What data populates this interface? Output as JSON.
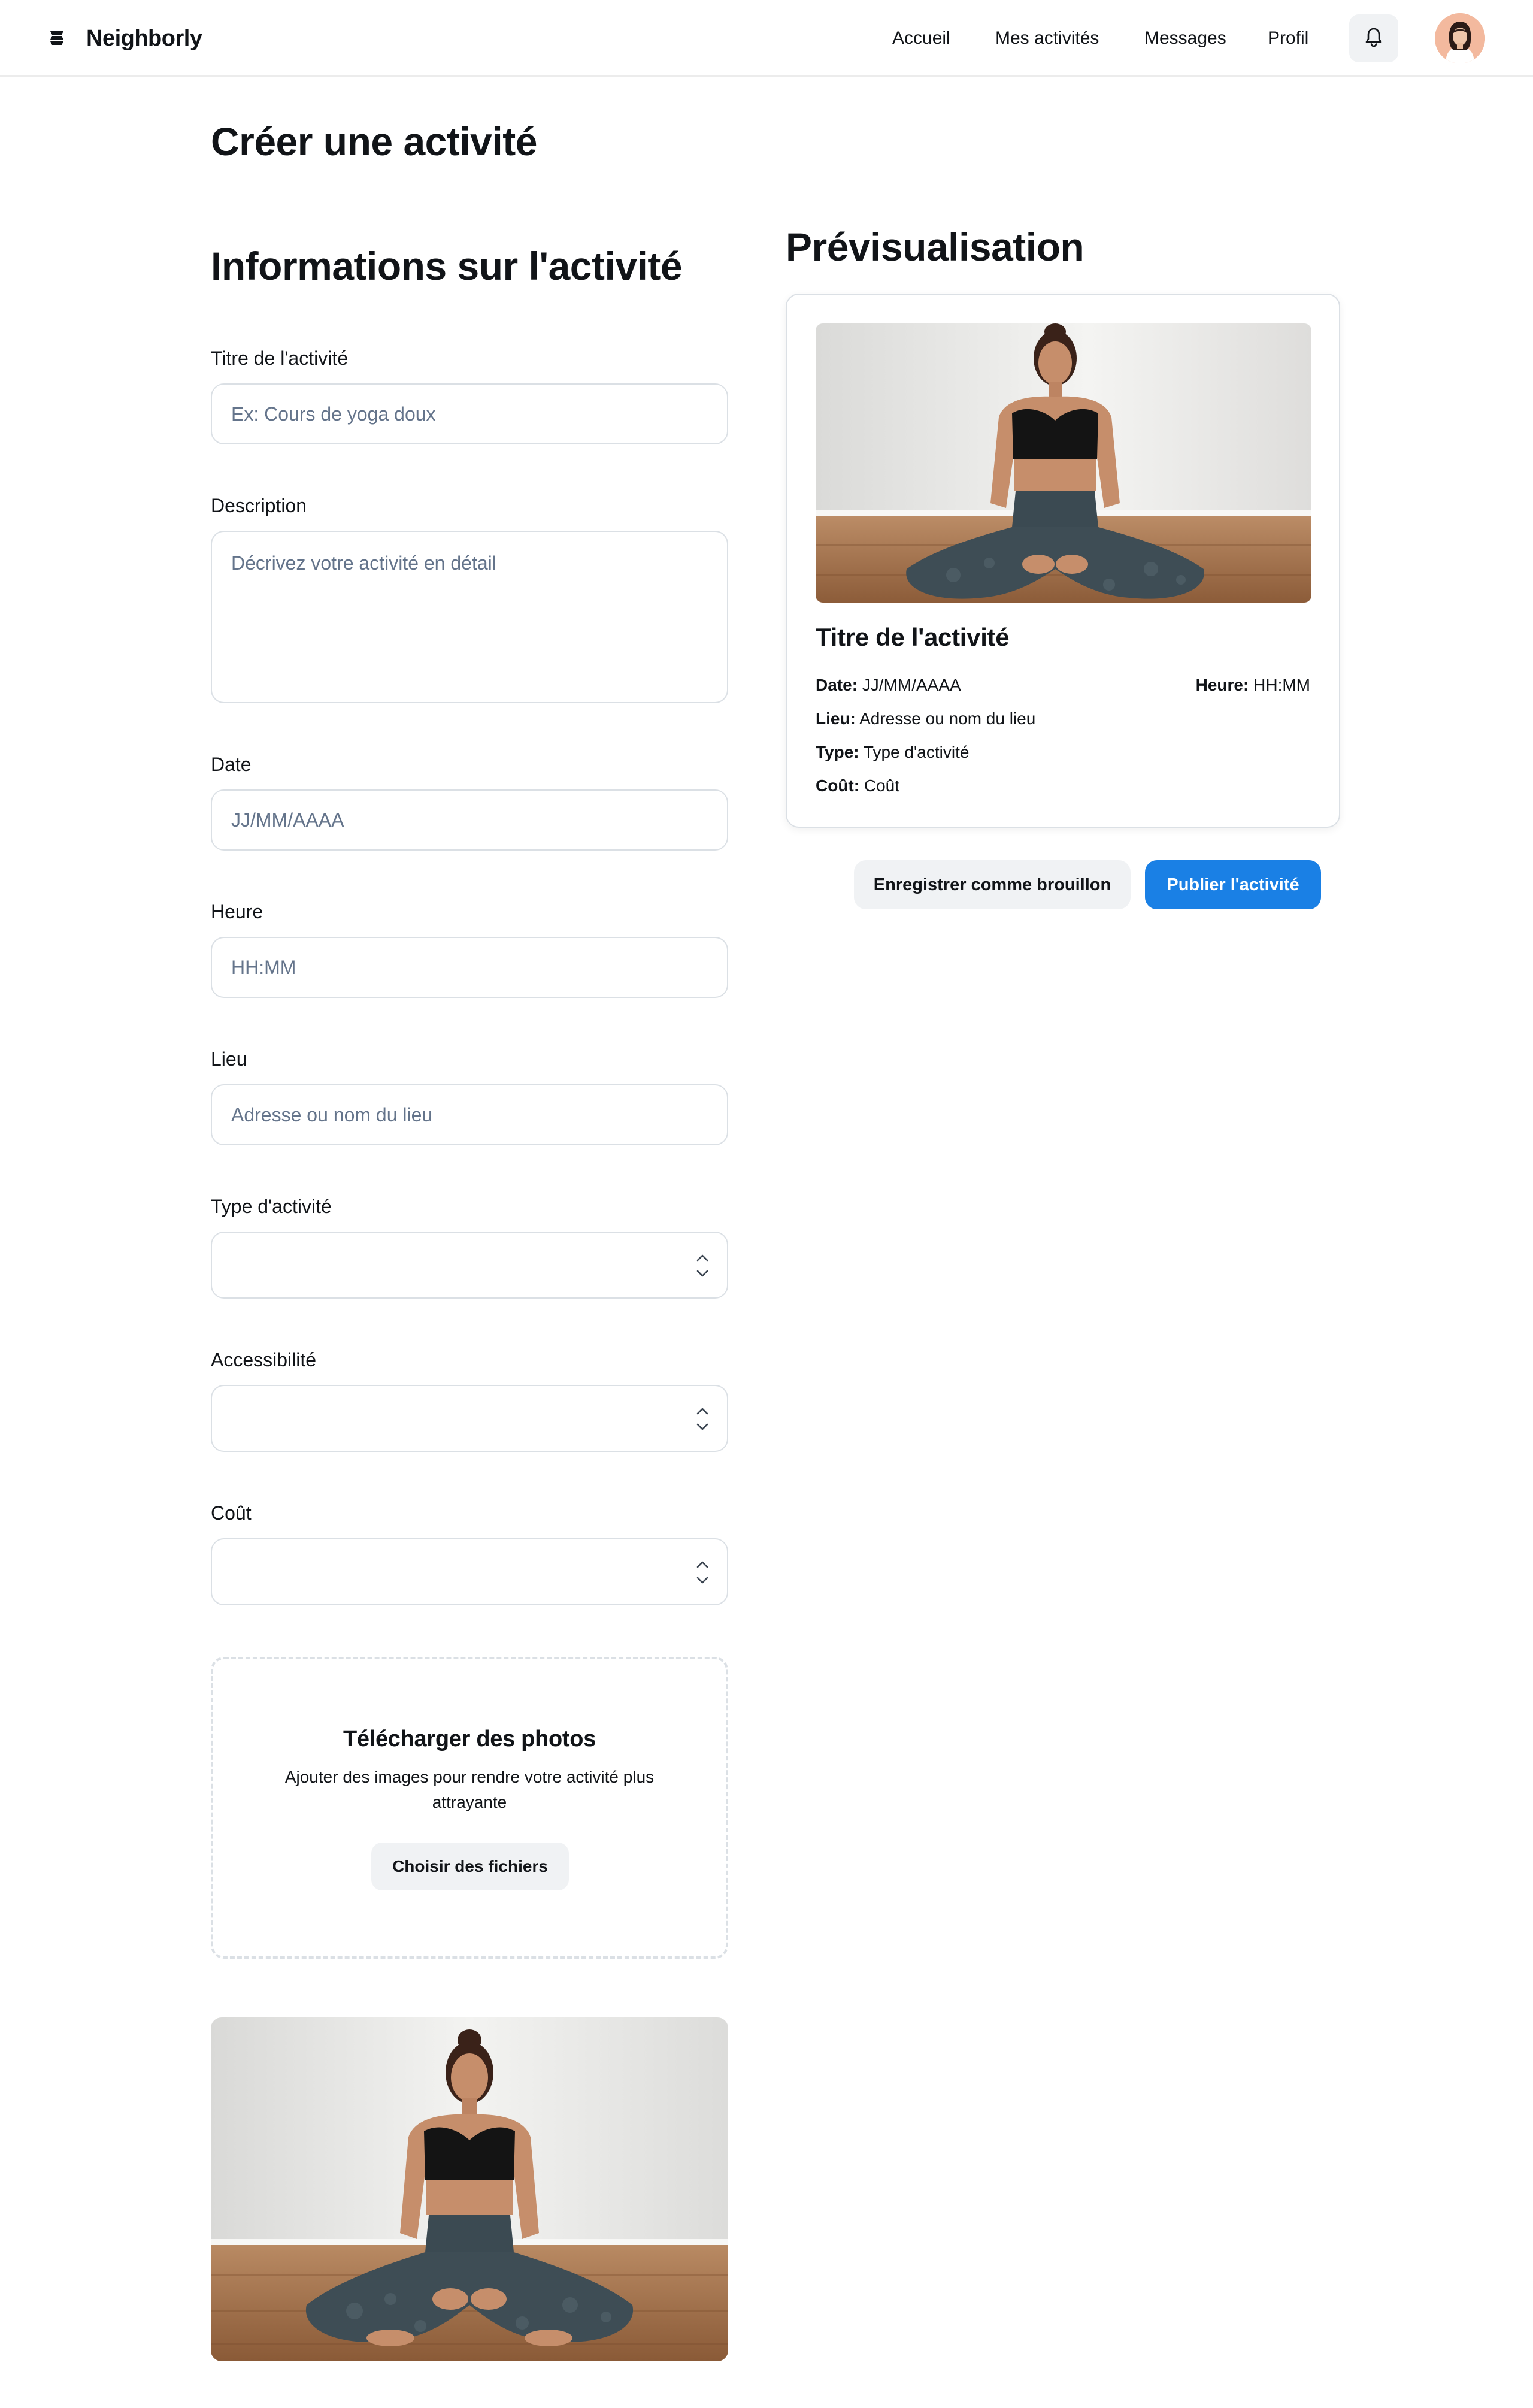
{
  "header": {
    "brand": "Neighborly",
    "nav": [
      "Accueil",
      "Mes activités",
      "Messages",
      "Profil"
    ],
    "icons": {
      "logo": "stacked-layers-icon",
      "notifications": "bell-icon",
      "avatar": "user-avatar"
    }
  },
  "page": {
    "title": "Créer une activité"
  },
  "form": {
    "section_title": "Informations sur l'activité",
    "title_label": "Titre de l'activité",
    "title_placeholder": "Ex: Cours de yoga doux",
    "description_label": "Description",
    "description_placeholder": "Décrivez votre activité en détail",
    "date_label": "Date",
    "date_placeholder": "JJ/MM/AAAA",
    "time_label": "Heure",
    "time_placeholder": "HH:MM",
    "location_label": "Lieu",
    "location_placeholder": "Adresse ou nom du lieu",
    "type_label": "Type d'activité",
    "accessibility_label": "Accessibilité",
    "cost_label": "Coût",
    "upload": {
      "title": "Télécharger des photos",
      "subtitle": "Ajouter des images pour rendre votre activité plus attrayante",
      "button": "Choisir des fichiers"
    }
  },
  "preview": {
    "title": "Prévisualisation",
    "card_title": "Titre de l'activité",
    "date_key": "Date:",
    "date_value": "JJ/MM/AAAA",
    "time_key": "Heure:",
    "time_value": "HH:MM",
    "location_key": "Lieu:",
    "location_value": "Adresse ou nom du lieu",
    "type_key": "Type:",
    "type_value": "Type d'activité",
    "cost_key": "Coût:",
    "cost_value": "Coût"
  },
  "actions": {
    "draft": "Enregistrer comme brouillon",
    "publish": "Publier l'activité"
  },
  "colors": {
    "primary": "#1a80e5",
    "border": "#dbe0e5",
    "muted_bg": "#f0f2f4",
    "placeholder": "#64748b"
  }
}
